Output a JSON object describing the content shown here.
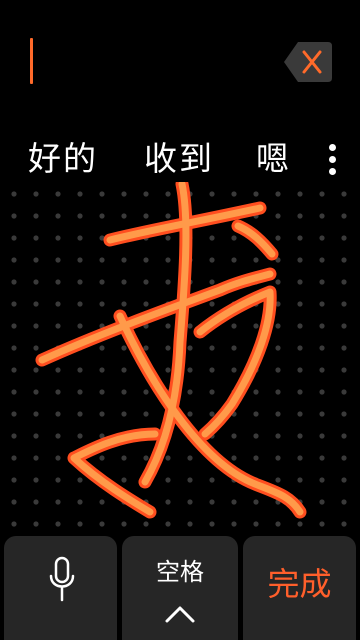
{
  "colors": {
    "accent": "#ff6a2a",
    "stroke_inner": "#ff9a4a",
    "stroke_outer": "#ff4e1f",
    "key_bg": "#262626",
    "dot": "#3a3a3a"
  },
  "candidates": [
    {
      "label": "好的"
    },
    {
      "label": "收到"
    },
    {
      "label": "嗯"
    }
  ],
  "icons": {
    "delete": "close-icon",
    "more": "more-vertical-icon",
    "mic": "mic-icon",
    "chevron": "chevron-up-icon"
  },
  "keys": {
    "space_label": "空格",
    "done_label": "完成"
  }
}
